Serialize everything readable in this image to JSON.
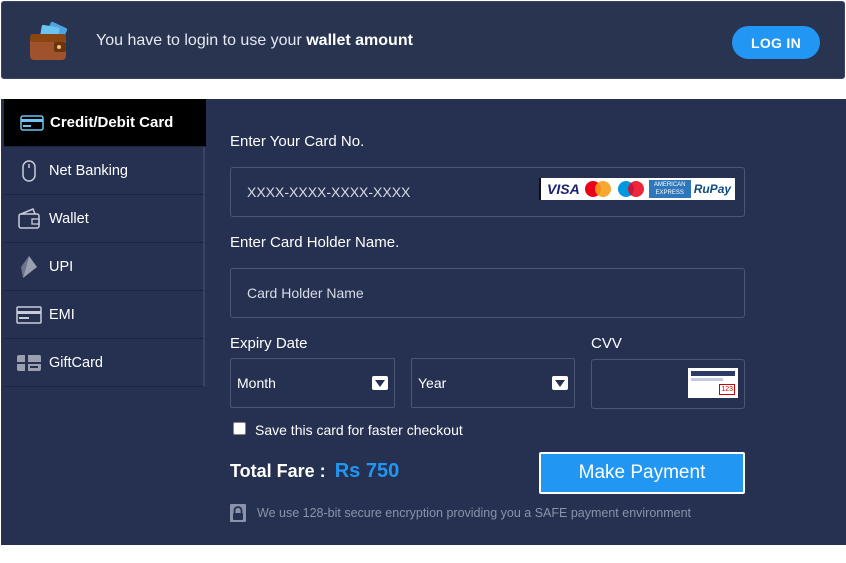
{
  "banner": {
    "text_prefix": "You have to login to use your ",
    "text_bold": "wallet amount",
    "login_label": "LOG IN"
  },
  "sidebar": {
    "items": [
      {
        "label": "Credit/Debit Card",
        "icon": "credit-card-icon"
      },
      {
        "label": "Net Banking",
        "icon": "mouse-icon"
      },
      {
        "label": "Wallet",
        "icon": "wallet-icon"
      },
      {
        "label": "UPI",
        "icon": "upi-icon"
      },
      {
        "label": "EMI",
        "icon": "emi-card-icon"
      },
      {
        "label": "GiftCard",
        "icon": "gift-card-icon"
      }
    ]
  },
  "form": {
    "card_no_label": "Enter Your Card No.",
    "card_no_placeholder": "XXXX-XXXX-XXXX-XXXX",
    "card_brands": [
      "VISA",
      "MasterCard",
      "Maestro",
      "AMERICAN EXPRESS",
      "RuPay"
    ],
    "holder_label": "Enter Card Holder Name.",
    "holder_placeholder": "Card Holder Name",
    "expiry_label": "Expiry Date",
    "month_value": "Month",
    "year_value": "Year",
    "cvv_label": "CVV",
    "cvv_hint": "123",
    "save_label": "Save this card for faster checkout"
  },
  "footer": {
    "total_label": "Total Fare :",
    "total_amount": "Rs 750",
    "pay_label": "Make Payment",
    "secure_text": "We use 128-bit secure encryption providing you a SAFE payment environment"
  },
  "colors": {
    "panel": "#263151",
    "accent": "#2196f3",
    "active_tab": "#000000"
  }
}
